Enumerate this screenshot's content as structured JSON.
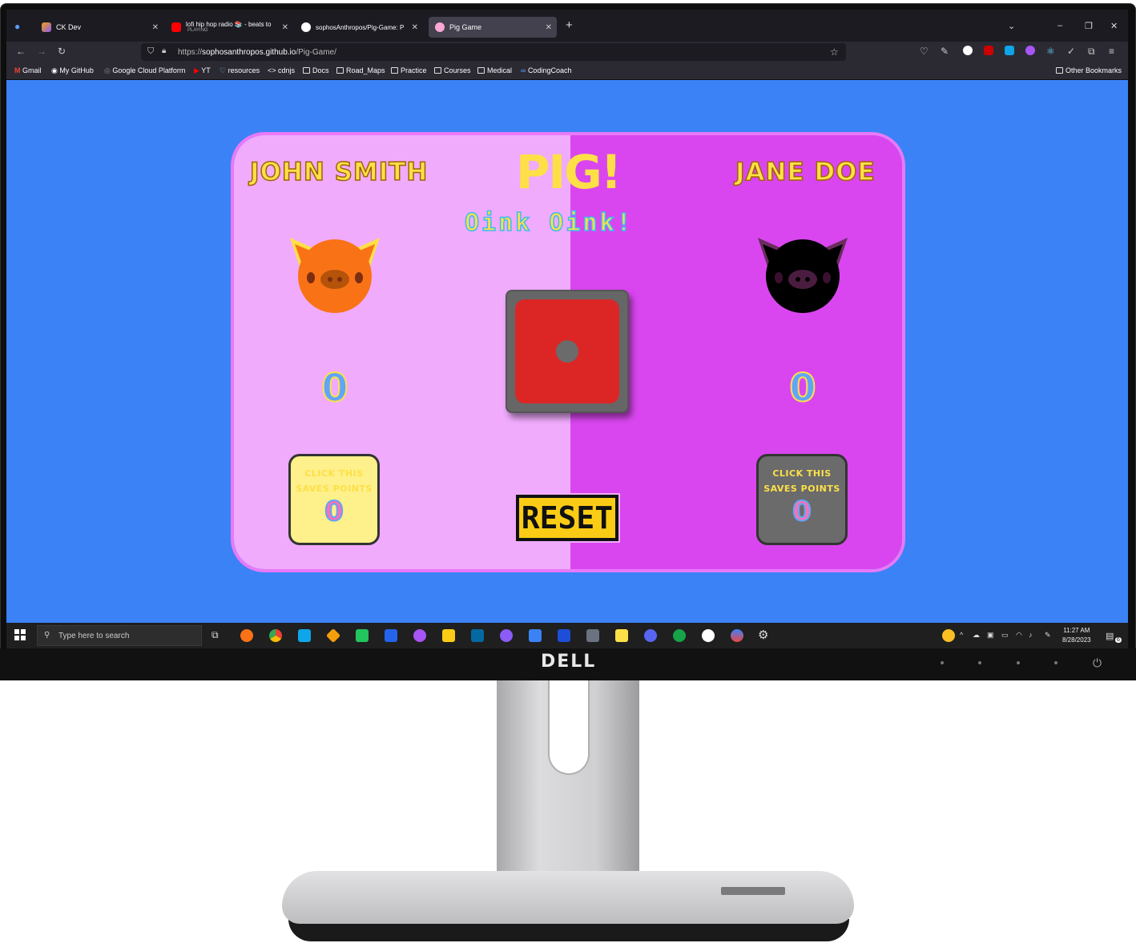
{
  "browser": {
    "tabs": [
      {
        "label": "CK Dev",
        "sub": "",
        "active": false
      },
      {
        "label": "lofi hip hop radio 📚 - beats to",
        "sub": "PLAYING",
        "active": false
      },
      {
        "label": "sophosAnthropos/Pig-Game: P",
        "sub": "",
        "active": false
      },
      {
        "label": "Pig Game",
        "sub": "",
        "active": true
      }
    ],
    "new_tab": "+",
    "url_prefix": "https://",
    "url_host": "sophosanthropos.github.io",
    "url_path": "/Pig-Game/",
    "bookmarks": [
      "Gmail",
      "My GitHub",
      "Google Cloud Platform",
      "YT",
      "resources",
      "cdnjs",
      "Docs",
      "Road_Maps",
      "Practice",
      "Courses",
      "Medical",
      "CodingCoach"
    ],
    "other_bookmarks": "Other Bookmarks"
  },
  "game": {
    "title": "PIG!",
    "subtitle": "Oink Oink!",
    "player1": {
      "name": "JOHN SMITH",
      "score": "0",
      "hold_text_1": "CLICK THIS",
      "hold_text_2": "SAVES POINTS",
      "current": "0"
    },
    "player2": {
      "name": "JANE DOE",
      "score": "0",
      "hold_text_1": "CLICK THIS",
      "hold_text_2": "SAVES POINTS",
      "current": "0"
    },
    "reset_label": "RESET",
    "colors": {
      "background": "#3b82f6",
      "player1_panel": "#f0abfc",
      "player2_panel": "#d946ef",
      "dice": "#dc2626",
      "accent": "#fde047"
    }
  },
  "taskbar": {
    "search_placeholder": "Type here to search",
    "time": "11:27 AM",
    "date": "8/28/2023",
    "notifications": "6"
  },
  "monitor": {
    "brand": "DELL"
  }
}
